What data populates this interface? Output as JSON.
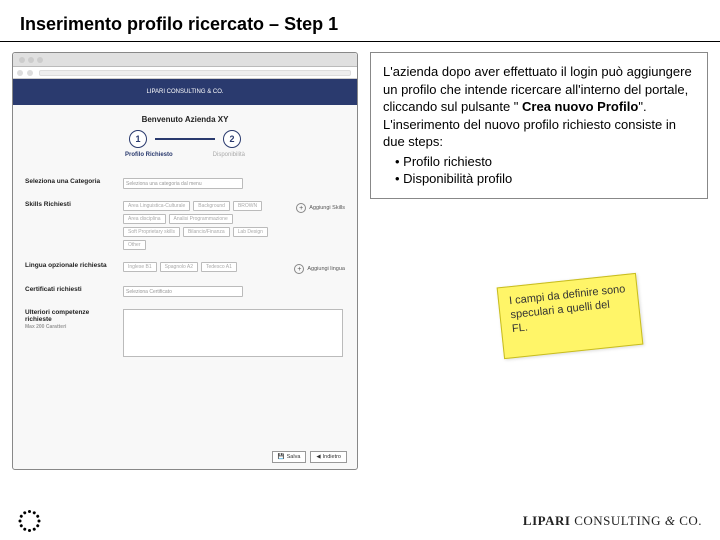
{
  "title": "Inserimento profilo ricercato – Step 1",
  "wireframe": {
    "banner": "LIPARI CONSULTING & CO.",
    "welcome": "Benvenuto Azienda XY",
    "steps": {
      "one": "1",
      "two": "2",
      "label1": "Profilo Richiesto",
      "label2": "Disponibilità"
    },
    "rows": {
      "categoria": {
        "label": "Seleziona una Categoria",
        "placeholder": "Seleziona una categoria dal menu"
      },
      "skills": {
        "label": "Skills Richiesti",
        "chips": [
          "Area Linguistica-Culturale",
          "Background",
          "BROWN",
          "Area disciplina",
          "Analisi Programmazione",
          "Soft Proprietary skills",
          "Bilancio/Finanza",
          "Lab Design",
          "Other"
        ],
        "add": "Aggiungi Skills"
      },
      "lingue": {
        "label": "Lingua opzionale richiesta",
        "chips": [
          "Inglese B1",
          "Spagnolo A2",
          "Tedesco A1"
        ],
        "add": "Aggiungi lingua"
      },
      "cert": {
        "label": "Certificati richiesti",
        "placeholder": "Seleziona Certificato"
      },
      "comp": {
        "label": "Ulteriori competenze richieste",
        "sub": "Max 200 Caratteri"
      }
    },
    "footer": {
      "save": "Salva",
      "back": "Indietro"
    }
  },
  "description": {
    "p1a": "L'azienda dopo aver effettuato il login può aggiungere un profilo che intende ricercare all'interno del portale, cliccando sul pulsante \"",
    "bold": " Crea nuovo Profilo",
    "p1b": "\".",
    "p2": "L'inserimento del nuovo profilo richiesto consiste in due steps:",
    "b1": "Profilo richiesto",
    "b2": "Disponibilità profilo"
  },
  "sticky": "I campi da definire sono speculari a quelli del FL.",
  "brand": {
    "a": "LIPARI",
    "b": " CONSULTING ",
    "c": "&",
    "d": " CO."
  }
}
